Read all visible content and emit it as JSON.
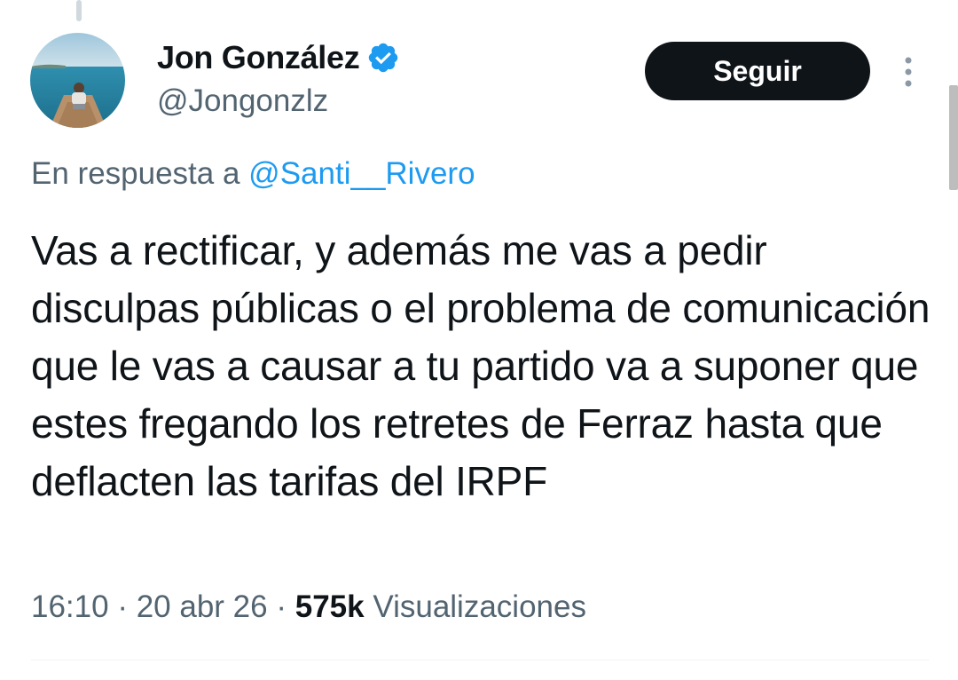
{
  "tweet": {
    "author": {
      "display_name": "Jon González",
      "handle": "@Jongonzlz",
      "verified": true
    },
    "follow_label": "Seguir",
    "reply_prefix": "En respuesta a",
    "reply_mention": "@Santi__Rivero",
    "text": "Vas a rectificar, y además me vas a pedir disculpas públicas o el problema de comunicación que le vas a causar a tu partido va a suponer que estes fregando los retretes de Ferraz hasta que deflacten las tarifas del IRPF",
    "time": "16:10",
    "separator": "·",
    "date": "20 abr 26",
    "views_count": "575k",
    "views_label": "Visualizaciones"
  },
  "icons": {
    "verified": "verified-badge-icon",
    "more": "more-vertical-icon"
  },
  "colors": {
    "accent": "#1d9bf0",
    "text_primary": "#0f1419",
    "text_secondary": "#536471",
    "button_bg": "#0f1419"
  }
}
